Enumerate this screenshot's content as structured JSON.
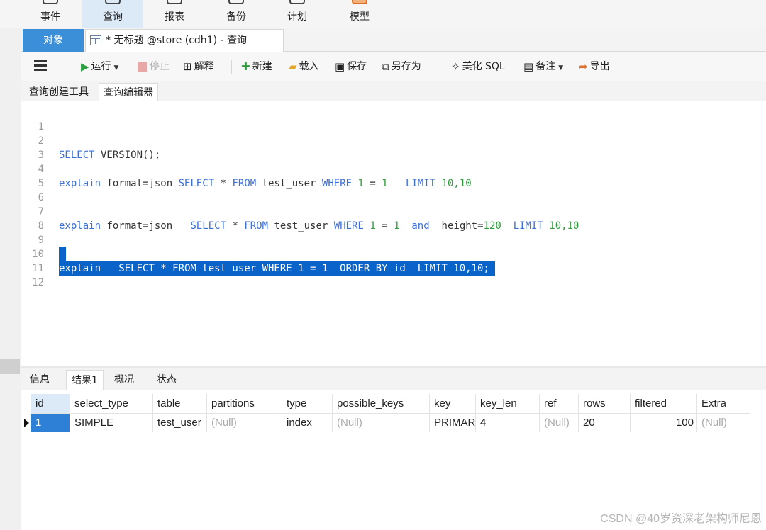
{
  "ribbon": {
    "items": [
      {
        "label": "事件",
        "icon": "event-icon",
        "active": false
      },
      {
        "label": "查询",
        "icon": "query-table-icon",
        "active": true
      },
      {
        "label": "报表",
        "icon": "report-icon",
        "active": false
      },
      {
        "label": "备份",
        "icon": "backup-icon",
        "active": false
      },
      {
        "label": "计划",
        "icon": "schedule-icon",
        "active": false
      },
      {
        "label": "模型",
        "icon": "model-icon",
        "active": false
      }
    ]
  },
  "doc_tabs": {
    "objects": "对象",
    "query": "* 无标题 @store (cdh1) - 查询"
  },
  "toolbar": {
    "run": "运行",
    "stop": "停止",
    "explain": "解释",
    "new": "新建",
    "load": "载入",
    "save": "保存",
    "save_as": "另存为",
    "beautify": "美化 SQL",
    "comment": "备注",
    "export": "导出"
  },
  "sub_tabs": [
    "查询创建工具",
    "查询编辑器"
  ],
  "editor": {
    "lines": [
      {
        "n": "1"
      },
      {
        "n": "2",
        "t1": "SELECT",
        "t2": " VERSION();"
      },
      {
        "n": "3"
      },
      {
        "n": "4",
        "t1": "explain",
        "t2": " format=json ",
        "t3": "SELECT",
        "t4": " * ",
        "t5": "FROM",
        "t6": " test_user ",
        "t7": "WHERE",
        "t8": " 1",
        "t9": " = ",
        "t10": "1",
        "t11": "   ",
        "t12": "LIMIT",
        "t13": " 10,10"
      },
      {
        "n": "5"
      },
      {
        "n": "6"
      },
      {
        "n": "7",
        "t1": "explain",
        "t2": " format=json   ",
        "t3": "SELECT",
        "t4": " * ",
        "t5": "FROM",
        "t6": " test_user ",
        "t7": "WHERE",
        "t8": " 1",
        "t9": " = ",
        "t10": "1",
        "t11": "  ",
        "t12": "and",
        "t13": "  height=",
        "t14": "120",
        "t15": "  ",
        "t16": "LIMIT",
        "t17": " 10,10"
      },
      {
        "n": "8"
      },
      {
        "n": "9"
      },
      {
        "n": "10",
        "text": "explain   SELECT * FROM test_user WHERE 1 = 1  ORDER BY id  LIMIT 10,10; "
      },
      {
        "n": "11"
      },
      {
        "n": "12"
      }
    ]
  },
  "result_tabs": [
    "信息",
    "结果1",
    "概况",
    "状态"
  ],
  "grid": {
    "columns": [
      "id",
      "select_type",
      "table",
      "partitions",
      "type",
      "possible_keys",
      "key",
      "key_len",
      "ref",
      "rows",
      "filtered",
      "Extra"
    ],
    "row": [
      "1",
      "SIMPLE",
      "test_user",
      "(Null)",
      "index",
      "(Null)",
      "PRIMAR",
      "4",
      "(Null)",
      "20",
      "100",
      "(Null)"
    ]
  },
  "watermark": "CSDN @40岁资深老架构师尼恩"
}
